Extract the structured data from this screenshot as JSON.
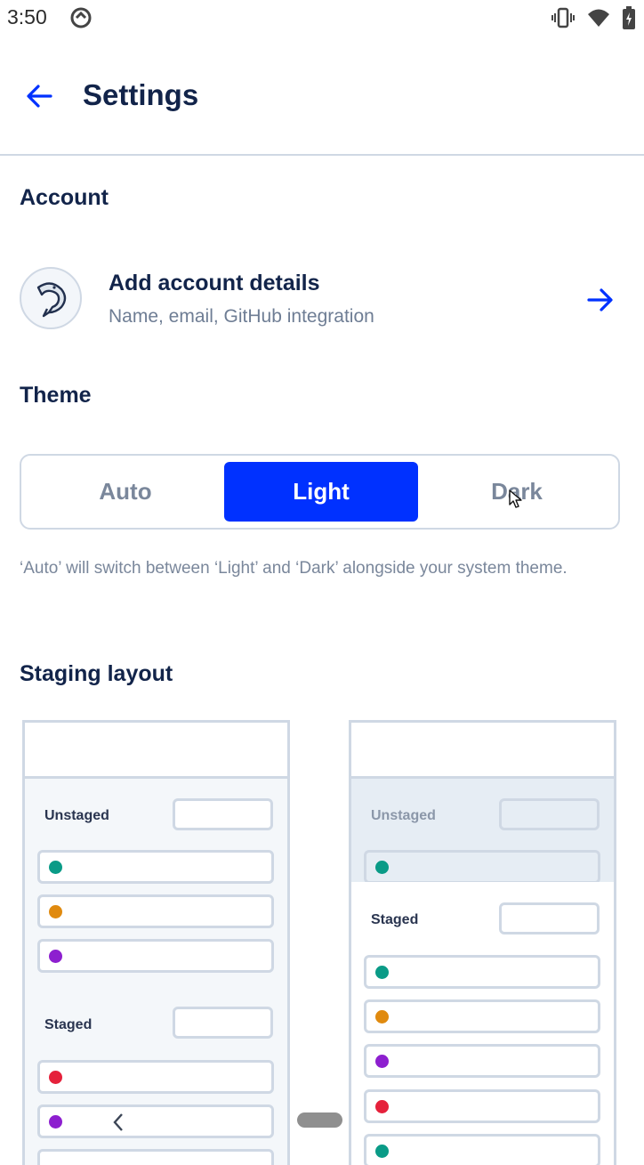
{
  "status_bar": {
    "time": "3:50",
    "left_icon": "data-saver-icon",
    "right_icons": [
      "vibrate-icon",
      "wifi-icon",
      "battery-charging-icon"
    ]
  },
  "app_bar": {
    "back_icon": "arrow-back-icon",
    "title": "Settings"
  },
  "account": {
    "section_title": "Account",
    "row_title": "Add account details",
    "row_subtitle": "Name, email, GitHub integration",
    "avatar_icon": "dolphin-icon",
    "arrow_icon": "arrow-forward-icon"
  },
  "theme": {
    "section_title": "Theme",
    "options": [
      "Auto",
      "Light",
      "Dark"
    ],
    "selected": "Light",
    "note": "‘Auto’ will switch between ‘Light’ and ‘Dark’ alongside your system theme."
  },
  "staging": {
    "section_title": "Staging layout",
    "left_card": {
      "unstaged_label": "Unstaged",
      "unstaged_dots": [
        "#0a9b87",
        "#e08a0f",
        "#8d1fcf"
      ],
      "staged_label": "Staged",
      "staged_dots": [
        "#e5213b",
        "#8d1fcf"
      ],
      "chevron_icon": "chevron-left-icon"
    },
    "right_card": {
      "unstaged_label": "Unstaged",
      "unstaged_dots": [
        "#0a9b87"
      ],
      "staged_label": "Staged",
      "staged_dots": [
        "#0a9b87",
        "#e08a0f",
        "#8d1fcf",
        "#e5213b",
        "#0a9b87"
      ]
    }
  },
  "colors": {
    "accent": "#0031ff",
    "text_primary": "#12244a",
    "text_secondary": "#6e7d94",
    "border": "#cfd8e4"
  }
}
